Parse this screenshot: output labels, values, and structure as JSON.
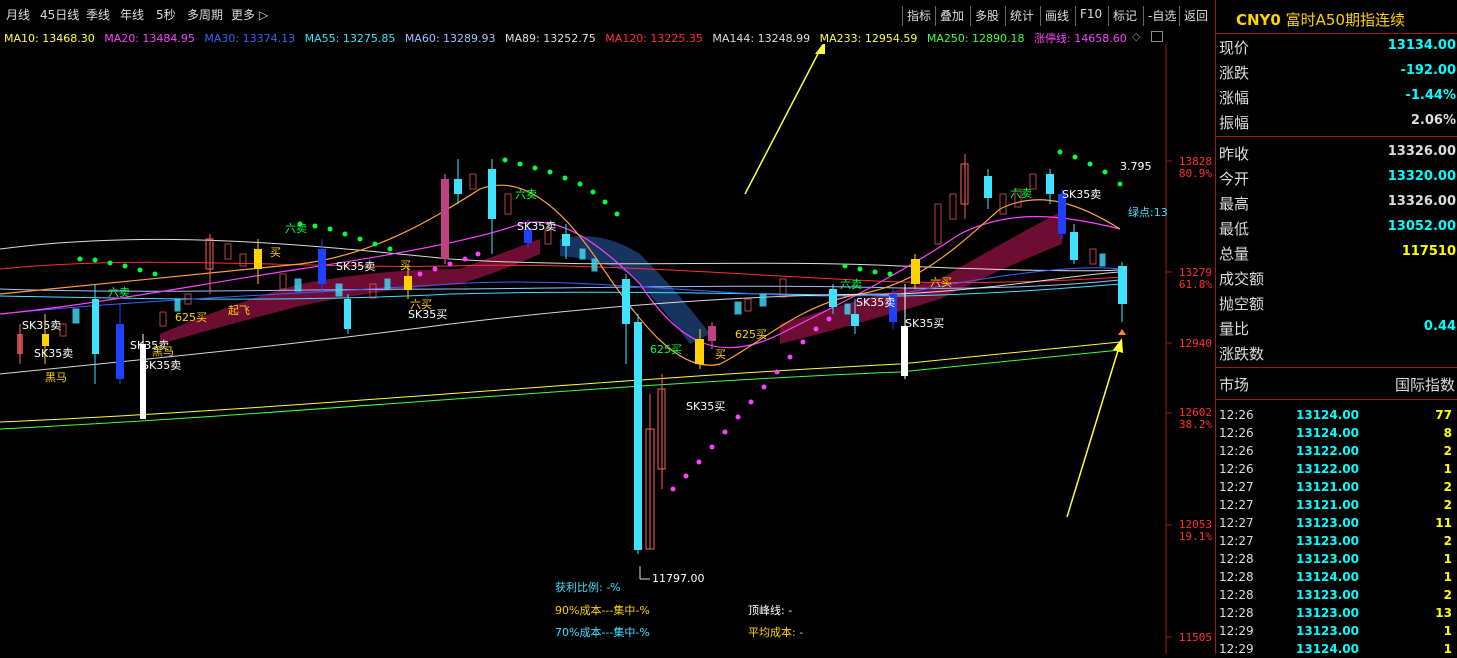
{
  "periods": [
    "月线",
    "45日线",
    "季线",
    "年线",
    "5秒",
    "多周期",
    "更多"
  ],
  "tools": [
    "指标",
    "叠加",
    "多股",
    "统计",
    "画线",
    "F10",
    "标记",
    "-自选",
    "返回"
  ],
  "ma_legend": [
    {
      "text": "MA10: 13468.30",
      "color": "#ffff40"
    },
    {
      "text": "MA20: 13484.95",
      "color": "#ff40ff"
    },
    {
      "text": "MA30: 13374.13",
      "color": "#4060ff"
    },
    {
      "text": "MA55: 13275.85",
      "color": "#40e0ff"
    },
    {
      "text": "MA60: 13289.93",
      "color": "#a0c0ff"
    },
    {
      "text": "MA89: 13252.75",
      "color": "#dddddd"
    },
    {
      "text": "MA120: 13225.35",
      "color": "#ff3030"
    },
    {
      "text": "MA144: 13248.99",
      "color": "#dddddd"
    },
    {
      "text": "MA233: 12954.59",
      "color": "#ffff40"
    },
    {
      "text": "MA250: 12890.18",
      "color": "#40ff40"
    },
    {
      "text": "涨停线: 14658.60",
      "color": "#ff40ff"
    }
  ],
  "axis": {
    "levels": [
      {
        "price": "13828",
        "pct": "80.9%"
      },
      {
        "price": "13279",
        "pct": "61.8%"
      },
      {
        "price": "12940",
        "pct": ""
      },
      {
        "price": "12602",
        "pct": "38.2%"
      },
      {
        "price": "12053",
        "pct": "19.1%"
      },
      {
        "price": "11505",
        "pct": ""
      }
    ]
  },
  "chart_labels": {
    "low_mark": "11797.00",
    "value_3795": "3.795",
    "green_point": "绿点:13",
    "sk35_sell": "SK35卖",
    "sk35_buy": "SK35买",
    "six_sell": "六卖",
    "six_buy": "六买",
    "buy625": "625买",
    "black_horse": "黑马",
    "buy": "买",
    "take_off": "起飞"
  },
  "stats": {
    "profit_ratio": "获利比例: -%",
    "cost90": "90%成本---集中-%",
    "cost70": "70%成本---集中-%",
    "peak_line": "顶峰线: -",
    "avg_cost": "平均成本: -"
  },
  "header": {
    "code": "CNY0",
    "name": "富时A50期指连续"
  },
  "quotes": [
    {
      "label": "现价",
      "value": "13134.00",
      "color": "#00ffff"
    },
    {
      "label": "涨跌",
      "value": "-192.00",
      "color": "#00ffff"
    },
    {
      "label": "涨幅",
      "value": "-1.44%",
      "color": "#00ffff"
    },
    {
      "label": "振幅",
      "value": "2.06%",
      "color": "#dddddd"
    },
    {
      "label": "昨收",
      "value": "13326.00",
      "color": "#dddddd"
    },
    {
      "label": "今开",
      "value": "13320.00",
      "color": "#00ffff"
    },
    {
      "label": "最高",
      "value": "13326.00",
      "color": "#dddddd"
    },
    {
      "label": "最低",
      "value": "13052.00",
      "color": "#00ffff"
    },
    {
      "label": "总量",
      "value": "117510",
      "color": "#ffff00"
    },
    {
      "label": "成交额",
      "value": "",
      "color": "#dddddd"
    },
    {
      "label": "抛空额",
      "value": "",
      "color": "#dddddd"
    },
    {
      "label": "量比",
      "value": "0.44",
      "color": "#00ffff"
    },
    {
      "label": "涨跌数",
      "value": "",
      "color": "#dddddd"
    }
  ],
  "market": {
    "label": "市场",
    "value": "国际指数"
  },
  "trades": [
    {
      "time": "12:26",
      "price": "13124.00",
      "vol": "77"
    },
    {
      "time": "12:26",
      "price": "13124.00",
      "vol": "8"
    },
    {
      "time": "12:26",
      "price": "13122.00",
      "vol": "2"
    },
    {
      "time": "12:26",
      "price": "13122.00",
      "vol": "1"
    },
    {
      "time": "12:27",
      "price": "13121.00",
      "vol": "2"
    },
    {
      "time": "12:27",
      "price": "13121.00",
      "vol": "2"
    },
    {
      "time": "12:27",
      "price": "13123.00",
      "vol": "11"
    },
    {
      "time": "12:27",
      "price": "13123.00",
      "vol": "2"
    },
    {
      "time": "12:28",
      "price": "13123.00",
      "vol": "1"
    },
    {
      "time": "12:28",
      "price": "13124.00",
      "vol": "1"
    },
    {
      "time": "12:28",
      "price": "13123.00",
      "vol": "2"
    },
    {
      "time": "12:28",
      "price": "13123.00",
      "vol": "13"
    },
    {
      "time": "12:29",
      "price": "13123.00",
      "vol": "1"
    },
    {
      "time": "12:29",
      "price": "13124.00",
      "vol": "1"
    }
  ]
}
